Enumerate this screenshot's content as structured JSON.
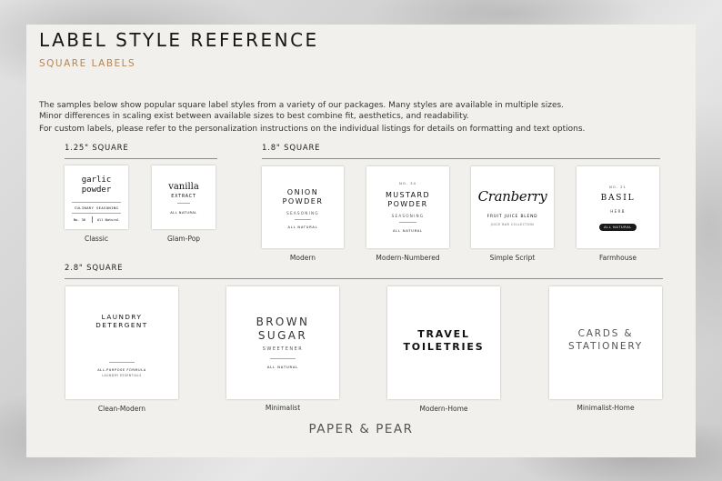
{
  "header": {
    "title": "LABEL STYLE REFERENCE",
    "subtitle": "SQUARE LABELS",
    "desc1": "The samples below show popular square label styles from a variety of our packages. Many styles are available in multiple sizes.",
    "desc2": "Minor differences in scaling exist between available sizes to best combine fit, aesthetics, and readability.",
    "desc3": "For custom labels, please refer to the personalization instructions on the individual listings for details on formatting and text options."
  },
  "sections": {
    "s125": "1.25\" SQUARE",
    "s18": "1.8\" SQUARE",
    "s28": "2.8\" SQUARE"
  },
  "labels": {
    "classic": {
      "caption": "Classic",
      "line1": "garlic",
      "line2": "powder",
      "sub": "CULINARY SEASONING",
      "no": "No. 36",
      "foot": "All Natural"
    },
    "glampop": {
      "caption": "Glam-Pop",
      "line1": "vanilla",
      "sub": "EXTRACT",
      "foot": "ALL NATURAL"
    },
    "modern": {
      "caption": "Modern",
      "line1": "ONION",
      "line2": "POWDER",
      "sub": "SEASONING",
      "foot": "ALL NATURAL"
    },
    "modernnum": {
      "caption": "Modern-Numbered",
      "no": "NO. 34",
      "line1": "MUSTARD",
      "line2": "POWDER",
      "sub": "SEASONING",
      "foot": "ALL NATURAL"
    },
    "script": {
      "caption": "Simple Script",
      "line1": "Cranberry",
      "sub": "FRUIT JUICE BLEND",
      "foot": "JUICE BAR COLLECTION"
    },
    "farmhouse": {
      "caption": "Farmhouse",
      "no": "NO. 21",
      "line1": "BASIL",
      "sub": "HERB",
      "foot": "ALL NATURAL"
    },
    "cleanmodern": {
      "caption": "Clean-Modern",
      "line1": "LAUNDRY",
      "line2": "DETERGENT",
      "sub": "ALL-PURPOSE FORMULA",
      "foot": "LAUNDRY ESSENTIALS"
    },
    "minimalist": {
      "caption": "Minimalist",
      "line1": "BROWN",
      "line2": "SUGAR",
      "sub": "SWEETENER",
      "foot": "ALL NATURAL"
    },
    "modernhome": {
      "caption": "Modern-Home",
      "line1": "TRAVEL",
      "line2": "TOILETRIES"
    },
    "minimalisthome": {
      "caption": "Minimalist-Home",
      "line1": "CARDS &",
      "line2": "STATIONERY"
    }
  },
  "brand": "PAPER & PEAR"
}
